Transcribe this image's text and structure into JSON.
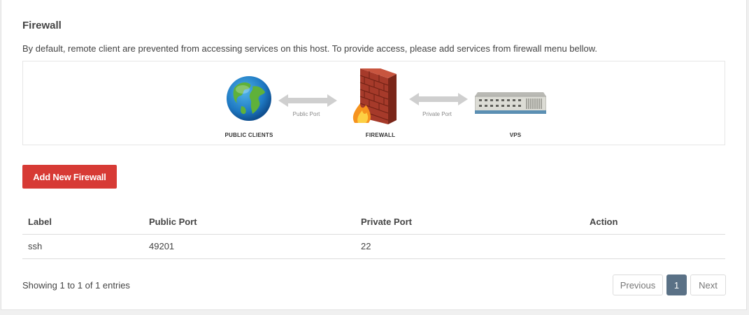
{
  "firewall": {
    "title": "Firewall",
    "description": "By default, remote client are prevented from accessing services on this host. To provide access, please add services from firewall menu bellow."
  },
  "diagram": {
    "public_clients_label": "PUBLIC CLIENTS",
    "firewall_label": "FIREWALL",
    "vps_label": "VPS",
    "public_port_caption": "Public Port",
    "private_port_caption": "Private Port",
    "icons": [
      "globe-icon",
      "firewall-icon",
      "server-icon"
    ]
  },
  "add_button_label": "Add New Firewall",
  "table": {
    "headers": [
      "Label",
      "Public Port",
      "Private Port",
      "Action"
    ],
    "rows": [
      {
        "label": "ssh",
        "public_port": "49201",
        "private_port": "22",
        "action": ""
      }
    ]
  },
  "pagination": {
    "info": "Showing 1 to 1 of 1 entries",
    "previous_label": "Previous",
    "current_page": "1",
    "next_label": "Next"
  },
  "colors": {
    "accent_red": "#d73a35",
    "pager_active": "#5a7186"
  }
}
